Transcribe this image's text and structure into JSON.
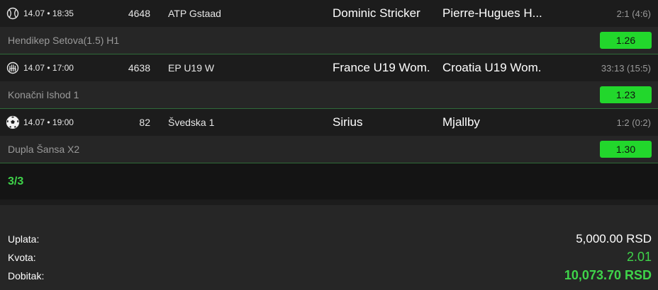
{
  "matches": [
    {
      "sport_icon": "tennis-ball-icon",
      "datetime": "14.07 • 18:35",
      "match_id": "4648",
      "league": "ATP Gstaad",
      "home": "Dominic Stricker",
      "away": "Pierre-Hugues H...",
      "score": "2:1  (4:6)",
      "bet_label": "Hendikep Setova(1.5) H1",
      "odd": "1.26"
    },
    {
      "sport_icon": "handball-icon",
      "datetime": "14.07 • 17:00",
      "match_id": "4638",
      "league": "EP U19 W",
      "home": "France U19 Wom.",
      "away": "Croatia U19 Wom.",
      "score": "33:13  (15:5)",
      "bet_label": "Konačni Ishod 1",
      "odd": "1.23"
    },
    {
      "sport_icon": "soccer-ball-icon",
      "datetime": "14.07 • 19:00",
      "match_id": "82",
      "league": "Švedska 1",
      "home": "Sirius",
      "away": "Mjallby",
      "score": "1:2  (0:2)",
      "bet_label": "Dupla Šansa X2",
      "odd": "1.30"
    }
  ],
  "count": "3/3",
  "summary": {
    "stake_label": "Uplata:",
    "stake_value": "5,000.00 RSD",
    "odds_label": "Kvota:",
    "odds_value": "2.01",
    "win_label": "Dobitak:",
    "win_value": "10,073.70 RSD"
  },
  "colors": {
    "accent_green": "#22d72c",
    "text_green": "#3fd44a",
    "background": "#1c1c1c",
    "bet_row_background": "#262626"
  }
}
